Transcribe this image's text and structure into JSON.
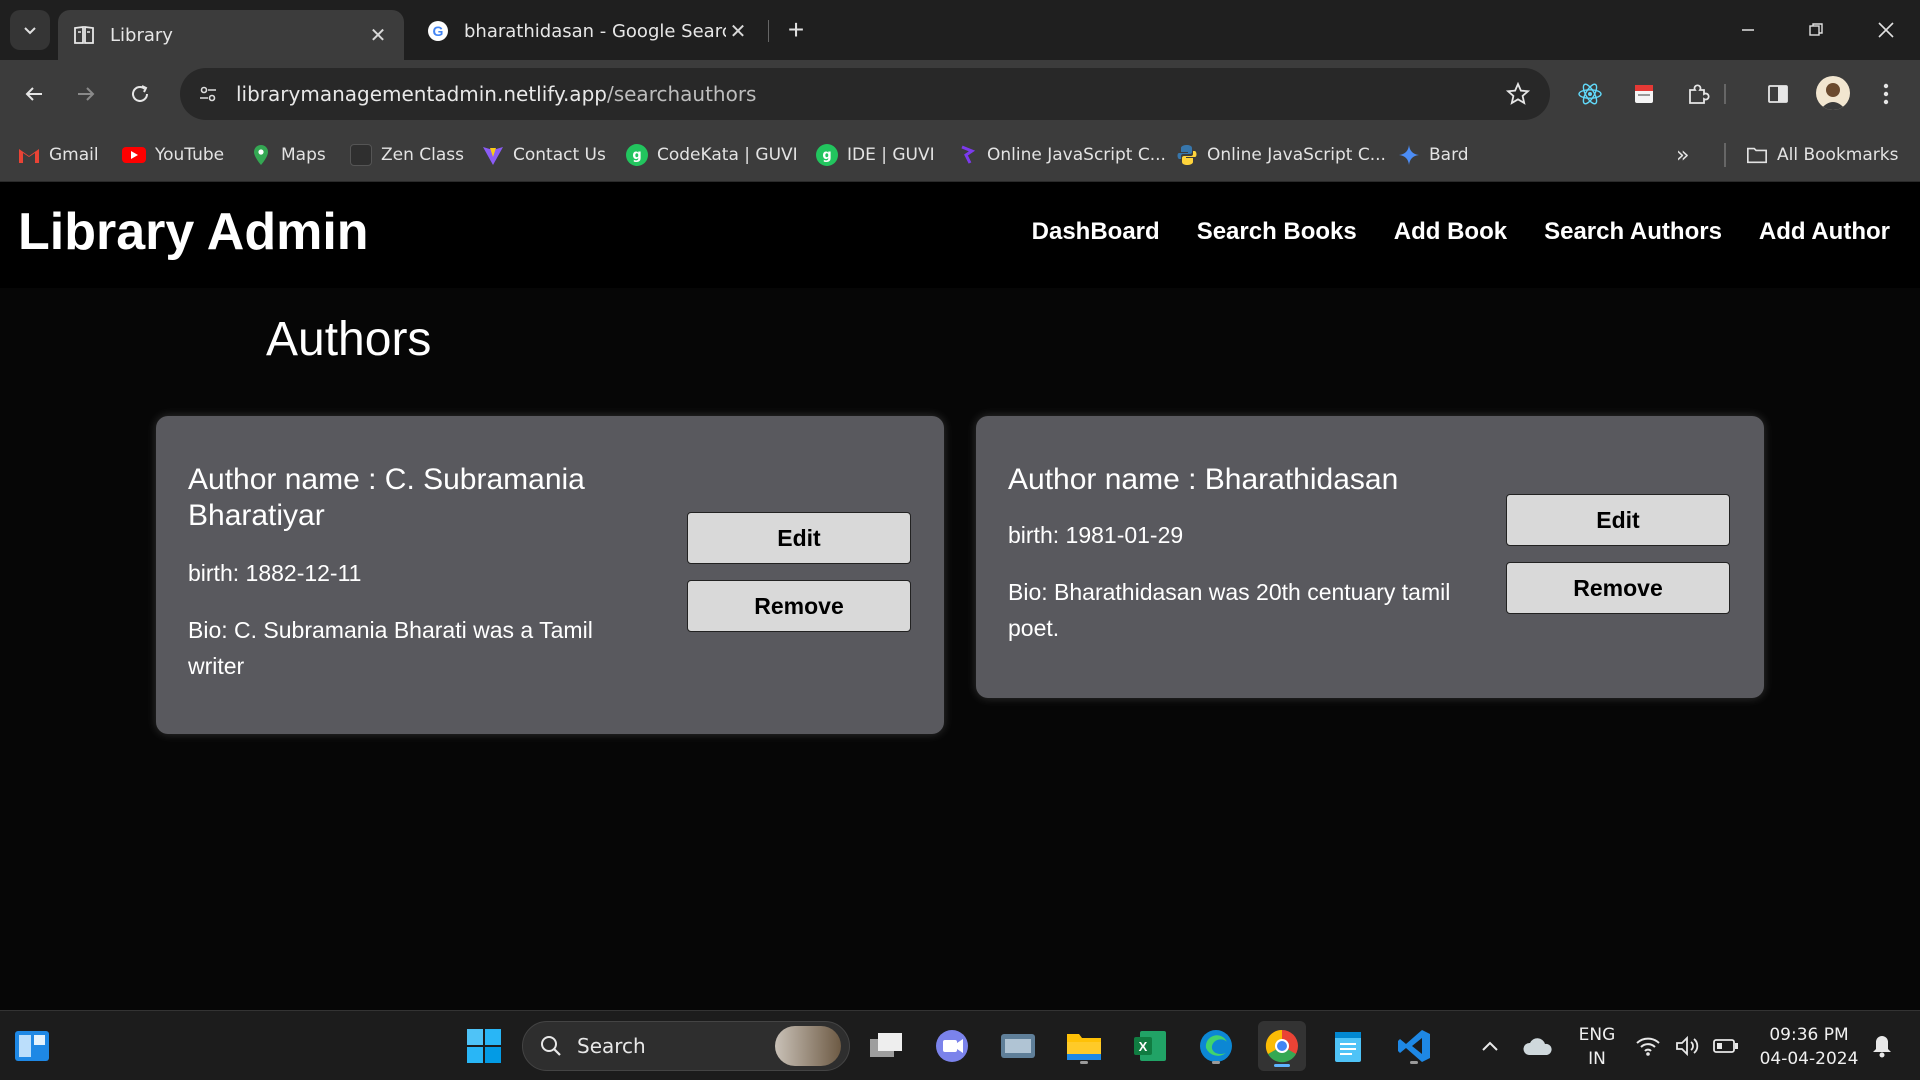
{
  "browser": {
    "tabs": [
      {
        "title": "Library",
        "icon": "book-icon",
        "active": true
      },
      {
        "title": "bharathidasan - Google Search",
        "icon": "google-icon",
        "active": false
      }
    ],
    "url_host": "librarymanagementadmin.netlify.app",
    "url_path": "/searchauthors",
    "bookmarks": [
      {
        "label": "Gmail",
        "icon": "gmail-icon"
      },
      {
        "label": "YouTube",
        "icon": "youtube-icon"
      },
      {
        "label": "Maps",
        "icon": "maps-icon"
      },
      {
        "label": "Zen Class",
        "icon": "zen-class-icon"
      },
      {
        "label": "Contact Us",
        "icon": "vite-icon"
      },
      {
        "label": "CodeKata | GUVI",
        "icon": "guvi-icon"
      },
      {
        "label": "IDE | GUVI",
        "icon": "guvi-icon"
      },
      {
        "label": "Online JavaScript C...",
        "icon": "js-compiler-icon"
      },
      {
        "label": "Online JavaScript C...",
        "icon": "python-icon"
      },
      {
        "label": "Bard",
        "icon": "bard-icon"
      }
    ],
    "all_bookmarks": "All Bookmarks"
  },
  "app": {
    "brand": "Library Admin",
    "nav": [
      "DashBoard",
      "Search Books",
      "Add Book",
      "Search Authors",
      "Add Author"
    ],
    "heading": "Authors",
    "authors": [
      {
        "name_line1": "Author name : C. Subramania",
        "name_line2": "Bharatiyar",
        "birth": "birth: 1882-12-11",
        "bio_line1": "Bio: C. Subramania Bharati was a Tamil",
        "bio_line2": "writer",
        "edit": "Edit",
        "remove": "Remove"
      },
      {
        "name_line1": "Author name : Bharathidasan",
        "birth": "birth: 1981-01-29",
        "bio_line1": "Bio: Bharathidasan was 20th centuary tamil",
        "bio_line2": "poet.",
        "edit": "Edit",
        "remove": "Remove"
      }
    ]
  },
  "taskbar": {
    "search_placeholder": "Search",
    "lang_line1": "ENG",
    "lang_line2": "IN",
    "time": "09:36 PM",
    "date": "04-04-2024"
  },
  "colors": {
    "card_bg": "#59595e",
    "button_bg": "#d9d9d9",
    "page_bg": "#000000"
  }
}
